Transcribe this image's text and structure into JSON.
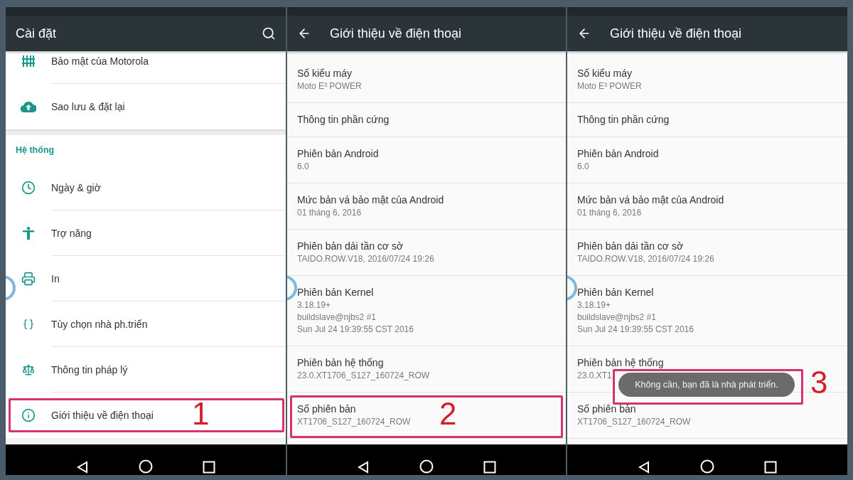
{
  "panels": [
    {
      "kind": "settings",
      "title": "Cài đặt",
      "items": [
        {
          "kind": "item",
          "label": "Bảo mật của Motorola"
        },
        {
          "kind": "item",
          "label": "Sao lưu & đặt lại"
        },
        {
          "kind": "header",
          "label": "Hệ thống"
        },
        {
          "kind": "item",
          "label": "Ngày & giờ"
        },
        {
          "kind": "item",
          "label": "Trợ năng"
        },
        {
          "kind": "item",
          "label": "In"
        },
        {
          "kind": "item",
          "label": "Tùy chọn nhà ph.triển"
        },
        {
          "kind": "item",
          "label": "Thông tin pháp lý"
        },
        {
          "kind": "item",
          "label": "Giới thiệu về điện thoại",
          "annotation": "1"
        }
      ]
    },
    {
      "kind": "about",
      "title": "Giới thiệu về điện thoại",
      "items": [
        {
          "title": "Số kiểu máy",
          "lines": [
            "Moto E³ POWER"
          ]
        },
        {
          "title": "Thông tin phần cứng"
        },
        {
          "title": "Phiên bản Android",
          "lines": [
            "6.0"
          ]
        },
        {
          "title": "Mức bản vá bảo mật của Android",
          "lines": [
            "01 tháng 6, 2016"
          ]
        },
        {
          "title": "Phiên bản dải tần cơ sở",
          "lines": [
            "TAIDO.ROW.V18, 2016/07/24 19:26"
          ]
        },
        {
          "title": "Phiên bản Kernel",
          "lines": [
            "3.18.19+",
            "buildslave@njbs2 #1",
            "Sun Jul 24 19:39:55 CST 2016"
          ]
        },
        {
          "title": "Phiên bản hệ thống",
          "lines": [
            "23.0.XT1706_S127_160724_ROW"
          ]
        },
        {
          "title": "Số phiên bản",
          "lines": [
            "XT1706_S127_160724_ROW"
          ],
          "annotation": "2"
        }
      ]
    },
    {
      "kind": "about",
      "title": "Giới thiệu về điện thoại",
      "items": [
        {
          "title": "Số kiểu máy",
          "lines": [
            "Moto E³ POWER"
          ]
        },
        {
          "title": "Thông tin phần cứng"
        },
        {
          "title": "Phiên bản Android",
          "lines": [
            "6.0"
          ]
        },
        {
          "title": "Mức bản vá bảo mật của Android",
          "lines": [
            "01 tháng 6, 2016"
          ]
        },
        {
          "title": "Phiên bản dải tần cơ sở",
          "lines": [
            "TAIDO.ROW.V18, 2016/07/24 19:26"
          ]
        },
        {
          "title": "Phiên bản Kernel",
          "lines": [
            "3.18.19+",
            "buildslave@njbs2 #1",
            "Sun Jul 24 19:39:55 CST 2016"
          ]
        },
        {
          "title": "Phiên bản hệ thống",
          "lines": [
            "23.0.XT1"
          ]
        },
        {
          "title": "Số phiên bản",
          "lines": [
            "XT1706_S127_160724_ROW"
          ]
        }
      ],
      "toast": {
        "text": "Không cần, bạn đã là nhà phát triển.",
        "annotation": "3"
      }
    }
  ]
}
